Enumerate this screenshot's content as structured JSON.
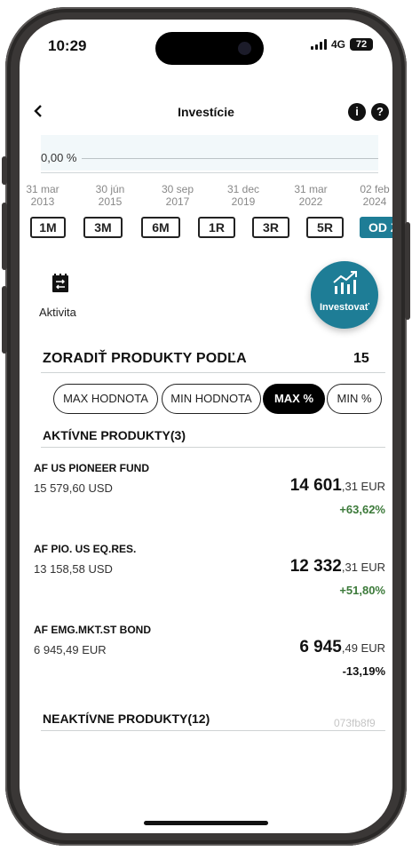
{
  "status_bar": {
    "time": "10:29",
    "network": "4G",
    "battery": "72"
  },
  "header": {
    "title": "Investície"
  },
  "chart": {
    "percent_label": "0,00 %",
    "dates": [
      {
        "day": "31 mar",
        "year": "2013"
      },
      {
        "day": "30 jún",
        "year": "2015"
      },
      {
        "day": "30 sep",
        "year": "2017"
      },
      {
        "day": "31 dec",
        "year": "2019"
      },
      {
        "day": "31 mar",
        "year": "2022"
      },
      {
        "day": "02 feb",
        "year": "2024"
      }
    ]
  },
  "periods": [
    "1M",
    "3M",
    "6M",
    "1R",
    "3R",
    "5R",
    "OD ZAČ."
  ],
  "active_period": "OD ZAČ.",
  "activity": {
    "label": "Aktivita"
  },
  "invest_button": {
    "label": "Investovať"
  },
  "sort": {
    "title": "ZORADIŤ PRODUKTY PODĽA",
    "count": "15",
    "options": [
      "MAX HODNOTA",
      "MIN HODNOTA",
      "MAX %",
      "MIN %"
    ],
    "active": "MAX %"
  },
  "active_section": {
    "title": "AKTÍVNE PRODUKTY(3)"
  },
  "products": [
    {
      "name": "AF US PIONEER FUND",
      "sub": "15 579,60 USD",
      "value_main": "14 601",
      "value_rest": ",31 EUR",
      "change": "+63,62%"
    },
    {
      "name": "AF PIO. US EQ.RES.",
      "sub": "13 158,58 USD",
      "value_main": "12 332",
      "value_rest": ",31 EUR",
      "change": "+51,80%"
    },
    {
      "name": "AF EMG.MKT.ST BOND",
      "sub": "6 945,49 EUR",
      "value_main": "6 945",
      "value_rest": ",49 EUR",
      "change": "-13,19%"
    }
  ],
  "inactive_section": {
    "title": "NEAKTÍVNE PRODUKTY(12)"
  },
  "build_hash": "073fb8f9",
  "colors": {
    "accent": "#1e7d96",
    "positive": "#3c7a3a",
    "chart_fill": "#f2f8fa"
  }
}
